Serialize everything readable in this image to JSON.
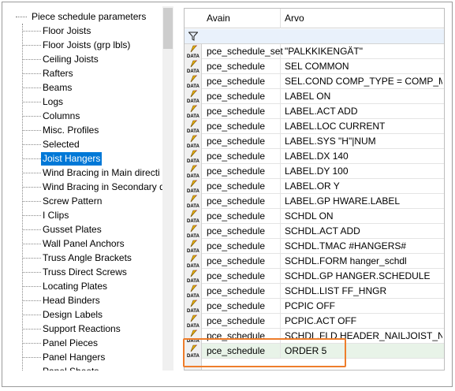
{
  "tree": {
    "root_label": "Piece schedule parameters",
    "items": [
      {
        "label": "Floor Joists"
      },
      {
        "label": "Floor Joists (grp lbls)"
      },
      {
        "label": "Ceiling Joists"
      },
      {
        "label": "Rafters"
      },
      {
        "label": "Beams"
      },
      {
        "label": "Logs"
      },
      {
        "label": "Columns"
      },
      {
        "label": "Misc. Profiles"
      },
      {
        "label": "Selected"
      },
      {
        "label": "Joist Hangers",
        "selected": true
      },
      {
        "label": "Wind Bracing in Main directi"
      },
      {
        "label": "Wind Bracing in Secondary d"
      },
      {
        "label": "Screw Pattern"
      },
      {
        "label": "I Clips"
      },
      {
        "label": "Gusset Plates"
      },
      {
        "label": "Wall Panel Anchors"
      },
      {
        "label": "Truss Angle Brackets"
      },
      {
        "label": "Truss Direct Screws"
      },
      {
        "label": "Locating Plates"
      },
      {
        "label": "Head Binders"
      },
      {
        "label": "Design Labels"
      },
      {
        "label": "Support Reactions"
      },
      {
        "label": "Panel Pieces"
      },
      {
        "label": "Panel Hangers"
      },
      {
        "label": "Panel Sheets"
      }
    ]
  },
  "grid": {
    "columns": [
      "Avain",
      "Arvo"
    ],
    "filter_icon": "funnel-icon",
    "row_icon": "data-pencil-icon",
    "row_icon_text": "DATA",
    "rows": [
      {
        "key": "pce_schedule_set",
        "value": "\"PALKKIKENGÄT\""
      },
      {
        "key": "pce_schedule",
        "value": "SEL COMMON"
      },
      {
        "key": "pce_schedule",
        "value": "SEL.COND COMP_TYPE = COMP_MA..."
      },
      {
        "key": "pce_schedule",
        "value": "LABEL ON"
      },
      {
        "key": "pce_schedule",
        "value": "LABEL.ACT ADD"
      },
      {
        "key": "pce_schedule",
        "value": "LABEL.LOC CURRENT"
      },
      {
        "key": "pce_schedule",
        "value": "LABEL.SYS \"H\"|NUM"
      },
      {
        "key": "pce_schedule",
        "value": "LABEL.DX 140"
      },
      {
        "key": "pce_schedule",
        "value": "LABEL.DY 100"
      },
      {
        "key": "pce_schedule",
        "value": "LABEL.OR Y"
      },
      {
        "key": "pce_schedule",
        "value": "LABEL.GP HWARE.LABEL"
      },
      {
        "key": "pce_schedule",
        "value": "SCHDL ON"
      },
      {
        "key": "pce_schedule",
        "value": "SCHDL.ACT ADD"
      },
      {
        "key": "pce_schedule",
        "value": "SCHDL.TMAC #HANGERS#"
      },
      {
        "key": "pce_schedule",
        "value": "SCHDL.FORM hanger_schdl"
      },
      {
        "key": "pce_schedule",
        "value": "SCHDL.GP HANGER.SCHEDULE"
      },
      {
        "key": "pce_schedule",
        "value": "SCHDL.LIST FF_HNGR"
      },
      {
        "key": "pce_schedule",
        "value": "PCPIC OFF"
      },
      {
        "key": "pce_schedule",
        "value": "PCPIC.ACT OFF"
      },
      {
        "key": "pce_schedule",
        "value": "SCHDL.FLD HEADER_NAILJOIST_N..."
      },
      {
        "key": "pce_schedule",
        "value": "ORDER 5"
      }
    ]
  },
  "colors": {
    "selection": "#0078d7",
    "highlight_box": "#ee7d2b",
    "filter_row": "#e9f1fb",
    "new_row": "#e8f3e8"
  }
}
